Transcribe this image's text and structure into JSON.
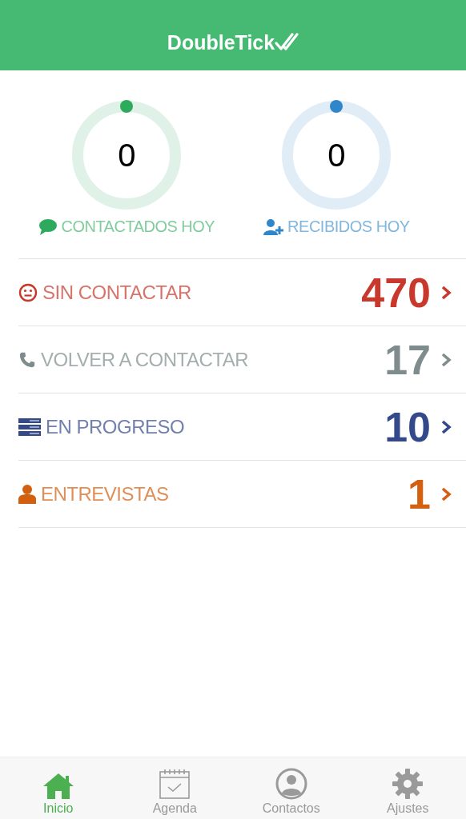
{
  "header": {
    "title": "DoubleTick"
  },
  "gauges": [
    {
      "value": "0",
      "label": "CONTACTADOS HOY",
      "kind": "chat",
      "color": "#2eaa5c"
    },
    {
      "value": "0",
      "label": "RECIBIDOS HOY",
      "kind": "user-add",
      "color": "#2f86c9"
    }
  ],
  "rows": [
    {
      "label": "SIN CONTACTAR",
      "count": "470",
      "kind": "face",
      "color": "#c8382c"
    },
    {
      "label": "VOLVER A CONTACTAR",
      "count": "17",
      "kind": "phone",
      "color": "#7f8c8d"
    },
    {
      "label": "EN PROGRESO",
      "count": "10",
      "kind": "list",
      "color": "#34498a"
    },
    {
      "label": "ENTREVISTAS",
      "count": "1",
      "kind": "person",
      "color": "#d35f11"
    }
  ],
  "tabs": [
    {
      "label": "Inicio",
      "kind": "home",
      "selected": true
    },
    {
      "label": "Agenda",
      "kind": "calendar",
      "selected": false
    },
    {
      "label": "Contactos",
      "kind": "contact",
      "selected": false
    },
    {
      "label": "Ajustes",
      "kind": "gear",
      "selected": false
    }
  ]
}
